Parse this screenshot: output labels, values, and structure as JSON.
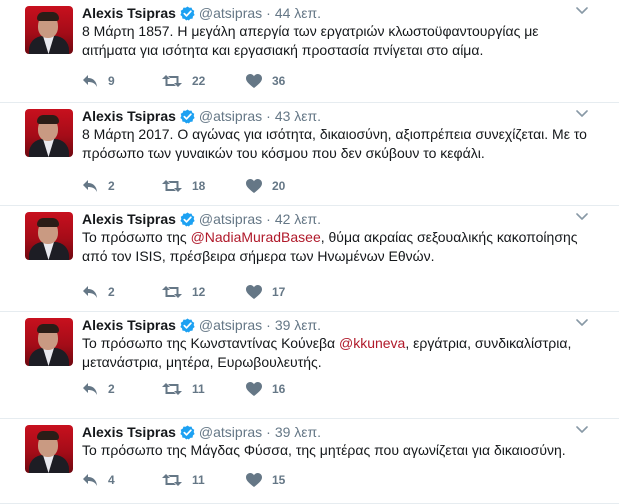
{
  "colors": {
    "link": "#b0192a",
    "verified": "#1da1f2",
    "muted": "#657786",
    "text": "#14171a"
  },
  "tweets": [
    {
      "name": "Alexis Tsipras",
      "handle": "@atsipras",
      "separator": "·",
      "time": "44 λεπ.",
      "text": "8 Μάρτη 1857. Η μεγάλη απεργία των εργατριών κλωστοϋφαντουργίας με αιτήματα για ισότητα και εργασιακή προστασία πνίγεται στο αίμα.",
      "replies": "9",
      "retweets": "22",
      "likes": "36"
    },
    {
      "name": "Alexis Tsipras",
      "handle": "@atsipras",
      "separator": "·",
      "time": "43 λεπ.",
      "text": "8 Μάρτη 2017. Ο αγώνας για ισότητα, δικαιοσύνη, αξιοπρέπεια συνεχίζεται. Με το πρόσωπο των γυναικών του κόσμου που δεν σκύβουν το κεφάλι.",
      "replies": "2",
      "retweets": "18",
      "likes": "20"
    },
    {
      "name": "Alexis Tsipras",
      "handle": "@atsipras",
      "separator": "·",
      "time": "42 λεπ.",
      "text_before": "Το πρόσωπο της ",
      "mention": "@NadiaMuradBasee",
      "text_after": ", θύμα ακραίας σεξουαλικής κακοποίησης από τον ISIS, πρέσβειρα σήμερα των Ηνωμένων Εθνών.",
      "replies": "2",
      "retweets": "12",
      "likes": "17"
    },
    {
      "name": "Alexis Tsipras",
      "handle": "@atsipras",
      "separator": "·",
      "time": "39 λεπ.",
      "text_before": "Το πρόσωπο της Κωνσταντίνας Κούνεβα ",
      "mention": "@kkuneva",
      "text_after": ", εργάτρια, συνδικαλίστρια, μετανάστρια, μητέρα, Ευρωβουλευτής.",
      "replies": "2",
      "retweets": "11",
      "likes": "16"
    },
    {
      "name": "Alexis Tsipras",
      "handle": "@atsipras",
      "separator": "·",
      "time": "39 λεπ.",
      "text": "Το πρόσωπο της Μάγδας Φύσσα, της μητέρας που αγωνίζεται για δικαιοσύνη.",
      "replies": "4",
      "retweets": "11",
      "likes": "15"
    }
  ],
  "icons": {
    "reply": "reply-icon",
    "retweet": "retweet-icon",
    "like": "heart-icon",
    "verified": "verified-badge-icon",
    "menu": "chevron-down-icon"
  }
}
